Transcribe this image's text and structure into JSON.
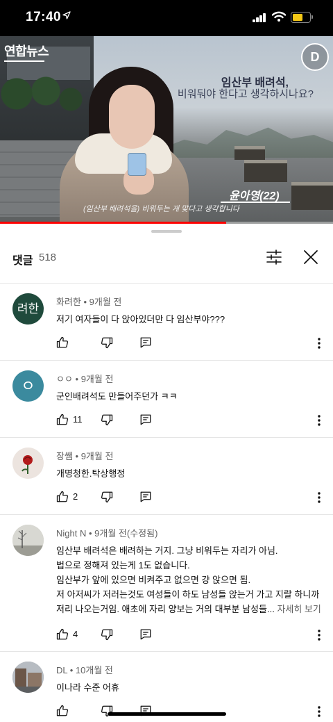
{
  "status_bar": {
    "time": "17:40",
    "location_icon": "location-arrow-icon",
    "signal_icon": "cellular-signal-icon",
    "wifi_icon": "wifi-icon",
    "battery_icon": "battery-icon",
    "battery_level": 0.62,
    "battery_color": "#f5c816"
  },
  "video": {
    "channel_logo": "연합뉴스",
    "corner_logo": "D",
    "title_line1": "임산부 배려석,",
    "title_line2": "비워둬야 한다고 생각하시나요?",
    "speaker_name": "윤아영(22)",
    "subtitle": "(임산부 배려석을) 비워두는 게 맞다고 생각합니다",
    "progress": 0.68,
    "progress_color": "#ff0000"
  },
  "comments_header": {
    "title": "댓글",
    "count": "518",
    "sort_icon": "sort-filter-icon",
    "close_icon": "close-icon"
  },
  "comments": [
    {
      "author": "화려한",
      "time": "9개월 전",
      "avatar_text": "려한",
      "avatar_color": "#1f4a3c",
      "text": "저기 여자들이 다 앉아있더만 다 임산부야???",
      "likes": ""
    },
    {
      "author": "ㅇㅇ",
      "time": "9개월 전",
      "avatar_text": "ㅇ",
      "avatar_color": "#3b8a9e",
      "text": "군인배려석도 만들어주던가 ㅋㅋ",
      "likes": "11"
    },
    {
      "author": "장쌤",
      "time": "9개월 전",
      "avatar_text": "",
      "avatar_color": "#ece4df",
      "text": "개명청한.탁상행정",
      "likes": "2"
    },
    {
      "author": "Night N",
      "time": "9개월 전(수정됨)",
      "avatar_text": "",
      "avatar_color": "#c8c8c0",
      "lines": [
        "임산부 배려석은 배려하는 거지. 그냥 비워두는 자리가 아님.",
        "법으로 정해져 있는게 1도 없습니다.",
        "임산부가 앞에 있으면 비켜주고 없으면 걍 앉으면 됨.",
        "저 아저씨가 저러는것도 여성들이 하도 남성들 앉는거 가고 지랄 하니까",
        "저리 나오는거임.  애초에 자리 양보는 거의 대부분 남성들..."
      ],
      "more": "자세히 보기",
      "likes": "4"
    },
    {
      "author": "DL",
      "time": "10개월 전",
      "avatar_text": "",
      "avatar_color": "#8a8f96",
      "text": "이나라 수준 어휴",
      "likes": ""
    }
  ],
  "meta_separator": " • "
}
